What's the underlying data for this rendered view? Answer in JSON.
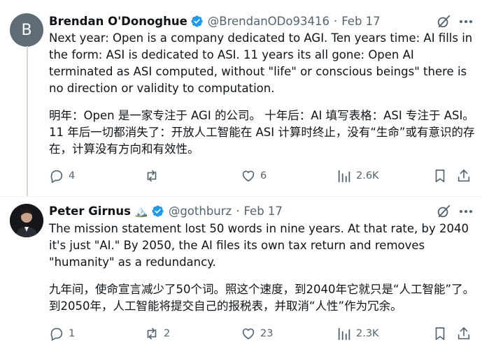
{
  "tweets": [
    {
      "avatar_letter": "B",
      "name": "Brendan O'Donoghue",
      "handle": "@BrendanODo93416",
      "dot": "·",
      "date": "Feb 17",
      "paragraphs": [
        "Next year: Open is a company dedicated to AGI.  Ten years time:  AI fills in the form:  ASI is dedicated to ASI.  11 years its all gone:  Open AI terminated as ASI computed, without \"life\" or conscious beings\" there is no direction or validity to computation.",
        "明年：Open 是一家专注于 AGI 的公司。 十年后：AI 填写表格：ASI 专注于 ASI。 11 年后一切都消失了：开放人工智能在 ASI 计算时终止，没有“生命”或有意识的存在，计算没有方向和有效性。"
      ],
      "replies": "4",
      "reposts": "",
      "likes": "6",
      "views": "2.6K"
    },
    {
      "name": "Peter Girnus",
      "name_emoji": "🏔️",
      "handle": "@gothburz",
      "dot": "·",
      "date": "Feb 17",
      "paragraphs": [
        "The mission statement lost 50 words in nine years. At that rate, by 2040 it's just \"AI.\" By 2050, the AI files its own tax return and removes \"humanity\" as a redundancy.",
        "九年间，使命宣言减少了50个词。照这个速度，到2040年它就只是“人工智能”了。到2050年，人工智能将提交自己的报税表，并取消“人性”作为冗余。"
      ],
      "replies": "1",
      "reposts": "2",
      "likes": "23",
      "views": "2.3K"
    }
  ],
  "colors": {
    "text": "#0f1419",
    "secondary": "#536471",
    "verified": "#1d9bf0",
    "divider": "#eff3f4",
    "thread_line": "#cfd9de"
  },
  "icons": [
    "verified-badge-icon",
    "grok-icon",
    "more-icon",
    "reply-icon",
    "repost-icon",
    "like-icon",
    "views-icon",
    "bookmark-icon",
    "share-icon"
  ]
}
